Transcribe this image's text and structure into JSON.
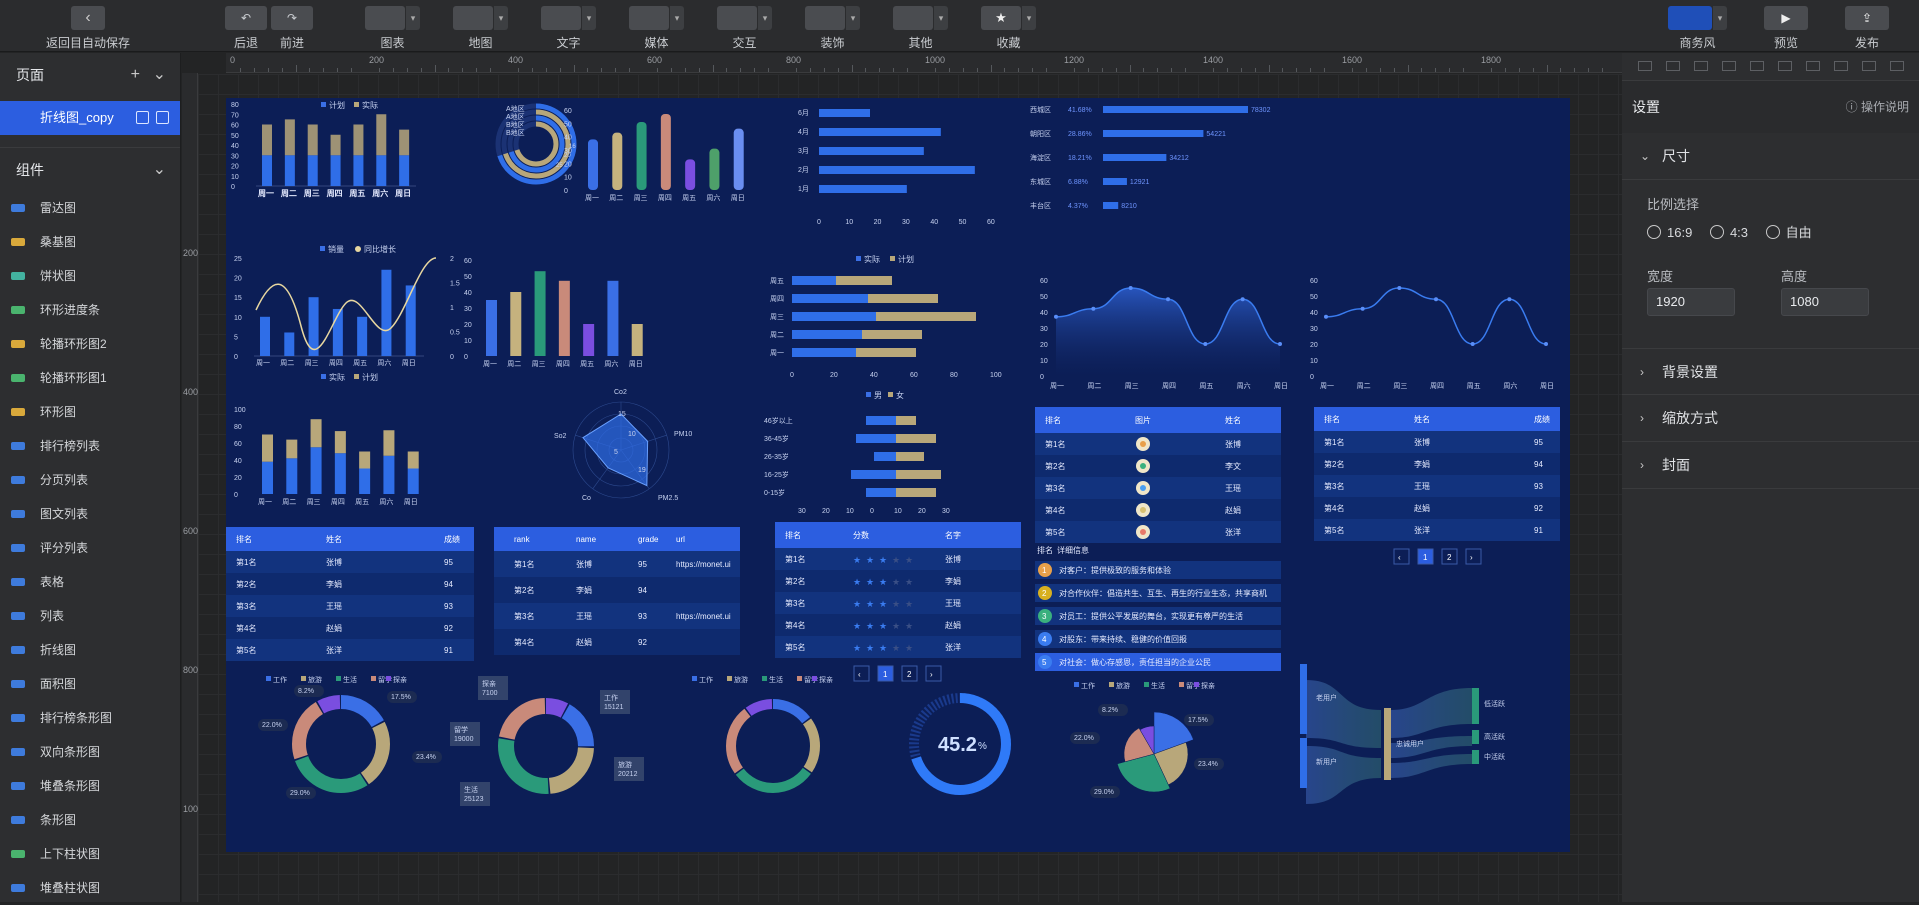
{
  "toolbar": {
    "back": "返回目自动保存",
    "undo": "后退",
    "redo": "前进",
    "charts": "图表",
    "map": "地图",
    "text": "文字",
    "media": "媒体",
    "interact": "交互",
    "decor": "装饰",
    "other": "其他",
    "fav": "收藏",
    "theme": "商务风",
    "preview": "预览",
    "publish": "发布"
  },
  "sidebar": {
    "pages_title": "页面",
    "page_name": "折线图_copy",
    "comps_title": "组件",
    "items": [
      "雷达图",
      "桑基图",
      "饼状图",
      "环形进度条",
      "轮播环形图2",
      "轮播环形图1",
      "环形图",
      "排行榜列表",
      "分页列表",
      "图文列表",
      "评分列表",
      "表格",
      "列表",
      "折线图",
      "面积图",
      "排行榜条形图",
      "双向条形图",
      "堆叠条形图",
      "条形图",
      "上下柱状图",
      "堆叠柱状图"
    ],
    "icon_colors": [
      "#3e7bdc",
      "#d9a93b",
      "#43b2a0",
      "#4ab46e",
      "#d9a93b",
      "#4ab46e",
      "#d9a93b",
      "#3e7bdc",
      "#3e7bdc",
      "#3e7bdc",
      "#3e7bdc",
      "#3e7bdc",
      "#3e7bdc",
      "#3e7bdc",
      "#3e7bdc",
      "#3e7bdc",
      "#3e7bdc",
      "#3e7bdc",
      "#3e7bdc",
      "#4ab46e",
      "#3e7bdc"
    ]
  },
  "ruler": {
    "h": [
      "0",
      "200",
      "400",
      "600",
      "800",
      "1000",
      "1200",
      "1400",
      "1600",
      "1800"
    ],
    "v": [
      "200",
      "400",
      "600",
      "800",
      "1000"
    ]
  },
  "settings": {
    "title": "设置",
    "help": "操作说明",
    "size": "尺寸",
    "ratio_label": "比例选择",
    "ratios": [
      "16:9",
      "4:3",
      "自由"
    ],
    "width_label": "宽度",
    "height_label": "高度",
    "width": "1920",
    "height": "1080",
    "bg": "背景设置",
    "scale": "缩放方式",
    "cover": "封面"
  },
  "colors": {
    "accent": "#2c5ee0",
    "board": "#0c1e56",
    "bar1": "#3a6fe6",
    "bar2": "#b8a77a"
  },
  "chart_data": [
    {
      "type": "bar",
      "name": "stacked-week",
      "categories": [
        "周一",
        "周二",
        "周三",
        "周四",
        "周五",
        "周六",
        "周日"
      ],
      "legend": [
        "计划",
        "实际"
      ],
      "yticks": [
        "80",
        "70",
        "60",
        "50",
        "40",
        "30",
        "20",
        "10",
        "0"
      ],
      "series": [
        {
          "name": "实际",
          "values": [
            30,
            30,
            30,
            30,
            30,
            30,
            30
          ]
        },
        {
          "name": "计划",
          "values": [
            30,
            35,
            30,
            20,
            30,
            40,
            25
          ]
        }
      ]
    },
    {
      "type": "bar",
      "name": "ring-bars",
      "labels": [
        "A地区",
        "A地区",
        "B地区",
        "B地区"
      ],
      "values": [
        16,
        16,
        20,
        25
      ]
    },
    {
      "type": "bar",
      "name": "week-bars",
      "categories": [
        "周一",
        "周二",
        "周三",
        "周四",
        "周五",
        "周六",
        "周日"
      ],
      "yticks": [
        "60",
        "50",
        "40",
        "30",
        "20",
        "10",
        "0"
      ],
      "values": [
        38,
        43,
        51,
        57,
        23,
        31,
        46
      ],
      "colors": [
        "#3a6fe6",
        "#c5b27e",
        "#2a9a7a",
        "#c98a7a",
        "#7a4ee0",
        "#4ea06a",
        "#6a8ef0"
      ]
    },
    {
      "type": "bar",
      "name": "month-bars",
      "categories": [
        "6月",
        "4月",
        "3月",
        "2月",
        "1月"
      ],
      "xticks": [
        "0",
        "10",
        "20",
        "30",
        "40",
        "50",
        "60"
      ],
      "values": [
        18,
        43,
        37,
        55,
        31
      ]
    },
    {
      "type": "bar",
      "name": "district-rank",
      "categories": [
        "西城区",
        "朝阳区",
        "海淀区",
        "东城区",
        "丰台区"
      ],
      "percents": [
        "41.68%",
        "28.86%",
        "18.21%",
        "6.88%",
        "4.37%"
      ],
      "values": [
        78302,
        54221,
        34212,
        12921,
        8210
      ]
    },
    {
      "type": "bar",
      "name": "sales-line",
      "categories": [
        "周一",
        "周二",
        "周三",
        "周四",
        "周五",
        "周六",
        "周日"
      ],
      "legend": [
        "销量",
        "同比增长"
      ],
      "yticks": [
        "25",
        "20",
        "15",
        "10",
        "5",
        "0"
      ],
      "y2ticks": [
        "2",
        "1.5",
        "1",
        "0.5",
        "0"
      ],
      "values": [
        10,
        6,
        15,
        12,
        10,
        22,
        18
      ]
    },
    {
      "type": "bar",
      "name": "color-bars",
      "categories": [
        "周一",
        "周二",
        "周三",
        "周四",
        "周五",
        "周六",
        "周日"
      ],
      "yticks": [
        "60",
        "50",
        "40",
        "30",
        "20",
        "10",
        "0"
      ],
      "values": [
        35,
        40,
        53,
        47,
        20,
        47,
        20
      ]
    },
    {
      "type": "bar",
      "name": "hbar-stacked",
      "categories": [
        "周五",
        "周四",
        "周三",
        "周二",
        "周一"
      ],
      "legend": [
        "实际",
        "计划"
      ],
      "xticks": [
        "0",
        "20",
        "40",
        "60",
        "80",
        "100"
      ],
      "series": [
        {
          "name": "实际",
          "values": [
            22,
            38,
            42,
            35,
            32
          ]
        },
        {
          "name": "计划",
          "values": [
            28,
            35,
            50,
            30,
            30
          ]
        }
      ]
    },
    {
      "type": "area",
      "name": "area-1",
      "categories": [
        "周一",
        "周二",
        "周三",
        "周四",
        "周五",
        "周六",
        "周日"
      ],
      "yticks": [
        "60",
        "50",
        "40",
        "30",
        "20",
        "10",
        "0"
      ],
      "values": [
        37,
        42,
        55,
        48,
        20,
        48,
        20
      ]
    },
    {
      "type": "line",
      "name": "line-1",
      "categories": [
        "周一",
        "周二",
        "周三",
        "周四",
        "周五",
        "周六",
        "周日"
      ],
      "yticks": [
        "60",
        "50",
        "40",
        "30",
        "20",
        "10",
        "0"
      ],
      "values": [
        37,
        42,
        55,
        48,
        20,
        48,
        20
      ]
    },
    {
      "type": "bar",
      "name": "stacked-2",
      "categories": [
        "周一",
        "周二",
        "周三",
        "周四",
        "周五",
        "周六",
        "周日"
      ],
      "legend": [
        "实际",
        "计划"
      ],
      "yticks": [
        "100",
        "80",
        "60",
        "40",
        "20",
        "0"
      ],
      "series": [
        {
          "name": "实际",
          "values": [
            38,
            42,
            55,
            48,
            30,
            45,
            30
          ]
        },
        {
          "name": "计划",
          "values": [
            32,
            22,
            33,
            26,
            20,
            30,
            20
          ]
        }
      ]
    },
    {
      "type": "scatter",
      "name": "radar",
      "axes": [
        "Co2",
        "PM10",
        "PM2.5",
        "Co",
        "So2"
      ],
      "rings": [
        "15",
        "10",
        "5",
        "19"
      ]
    },
    {
      "type": "bar",
      "name": "age-bars",
      "categories": [
        "46岁以上",
        "36-45岁",
        "26-35岁",
        "16-25岁",
        "0-15岁"
      ],
      "legend": [
        "男",
        "女"
      ],
      "xticks": [
        "30",
        "20",
        "10",
        "0",
        "10",
        "20",
        "30"
      ]
    },
    {
      "type": "pie",
      "name": "donut-1",
      "legend": [
        "工作",
        "旅游",
        "生活",
        "留学",
        "探亲"
      ],
      "labels": [
        "17.5%",
        "23.4%",
        "29.0%",
        "22.0%",
        "8.2%"
      ],
      "values": [
        17.5,
        23.4,
        29,
        22,
        8.2
      ]
    },
    {
      "type": "pie",
      "name": "donut-2",
      "labels": [
        "探亲 7100",
        "工作 15121",
        "旅游 20212",
        "生活 25123",
        "留学 19000"
      ],
      "values": [
        7100,
        15121,
        20212,
        25123,
        19000
      ]
    },
    {
      "type": "pie",
      "name": "donut-3",
      "legend": [
        "工作",
        "旅游",
        "生活",
        "留学",
        "探亲"
      ],
      "values": [
        15,
        20,
        30,
        25,
        10
      ]
    },
    {
      "type": "pie",
      "name": "progress",
      "value": "45.2",
      "unit": "%"
    },
    {
      "type": "pie",
      "name": "rose",
      "legend": [
        "工作",
        "旅游",
        "生活",
        "留学",
        "探亲"
      ],
      "labels": [
        "17.5%",
        "23.4%",
        "29.0%",
        "22.0%",
        "8.2%"
      ]
    },
    {
      "type": "scatter",
      "name": "sankey",
      "nodes": [
        "老用户",
        "新用户",
        "忠诚用户",
        "低活跃",
        "高活跃",
        "中活跃"
      ]
    }
  ],
  "tables": {
    "rank1": {
      "headers": [
        "排名",
        "姓名",
        "成绩"
      ],
      "rows": [
        [
          "第1名",
          "张博",
          "95"
        ],
        [
          "第2名",
          "李娟",
          "94"
        ],
        [
          "第3名",
          "王瑶",
          "93"
        ],
        [
          "第4名",
          "赵娟",
          "92"
        ],
        [
          "第5名",
          "张洋",
          "91"
        ]
      ]
    },
    "rank2": {
      "headers": [
        "rank",
        "name",
        "grade",
        "url"
      ],
      "rows": [
        [
          "第1名",
          "张博",
          "95",
          "https://monet.ui"
        ],
        [
          "第2名",
          "李娟",
          "94",
          ""
        ],
        [
          "第3名",
          "王瑶",
          "93",
          "https://monet.ui"
        ],
        [
          "第4名",
          "赵娟",
          "92",
          ""
        ]
      ]
    },
    "score": {
      "headers": [
        "排名",
        "分数",
        "名字"
      ],
      "rows": [
        [
          "第1名",
          "张博"
        ],
        [
          "第2名",
          "李娟"
        ],
        [
          "第3名",
          "王瑶"
        ],
        [
          "第4名",
          "赵娟"
        ],
        [
          "第5名",
          "张洋"
        ]
      ],
      "pages": [
        "1",
        "2"
      ]
    },
    "pic": {
      "headers": [
        "排名",
        "图片",
        "姓名"
      ],
      "rows": [
        [
          "第1名",
          "张博"
        ],
        [
          "第2名",
          "李文"
        ],
        [
          "第3名",
          "王瑶"
        ],
        [
          "第4名",
          "赵娟"
        ],
        [
          "第5名",
          "张洋"
        ]
      ]
    },
    "rank3": {
      "headers": [
        "排名",
        "姓名",
        "成绩"
      ],
      "rows": [
        [
          "第1名",
          "张博",
          "95"
        ],
        [
          "第2名",
          "李娟",
          "94"
        ],
        [
          "第3名",
          "王瑶",
          "93"
        ],
        [
          "第4名",
          "赵娟",
          "92"
        ],
        [
          "第5名",
          "张洋",
          "91"
        ]
      ],
      "pages": [
        "1",
        "2"
      ]
    },
    "info": {
      "headers": [
        "排名",
        "详细信息"
      ],
      "rows": [
        "对客户：提供极致的服务和体验",
        "对合作伙伴：倡造共生、互生、再生的行业生态，共享商机",
        "对员工：提供公平发展的舞台，实现更有尊严的生活",
        "对股东：带来持续、稳健的价值回报",
        "对社会：做心存感恩，责任担当的企业公民"
      ]
    }
  }
}
